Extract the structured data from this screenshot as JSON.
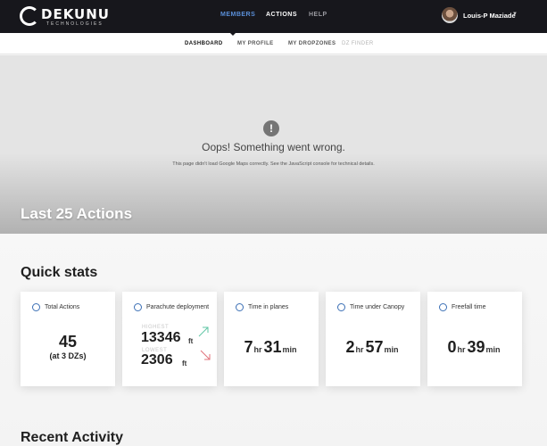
{
  "header": {
    "logo_word": "DEKUNU",
    "logo_tagline": "TECHNOLOGIES",
    "nav": [
      {
        "label": "MEMBERS"
      },
      {
        "label": "ACTIONS"
      },
      {
        "label": "HELP"
      }
    ],
    "user_name": "Louis-P Maziade",
    "colors": {
      "bar": "#17171c",
      "active_link": "#5a8fd8"
    }
  },
  "subnav": {
    "items": [
      {
        "label": "DASHBOARD"
      },
      {
        "label": "MY PROFILE"
      },
      {
        "label": "MY DROPZONES"
      },
      {
        "label": "DZ FINDER"
      }
    ]
  },
  "map": {
    "error_title": "Oops! Something went wrong.",
    "error_detail": "This page didn't load Google Maps correctly. See the JavaScript console for technical details.",
    "overlay_title": "Last 25 Actions"
  },
  "quick_stats": {
    "title": "Quick stats",
    "cards": [
      {
        "label": "Total Actions",
        "icon": "stopwatch-icon",
        "value": "45",
        "sub": "(at 3 DZs)"
      },
      {
        "label": "Parachute deployment",
        "icon": "parachute-icon",
        "ghost_top": "HIGHEST",
        "value_top": "13346",
        "unit_top": "ft",
        "ghost_bottom": "LOWEST",
        "value_bottom": "2306",
        "unit_bottom": "ft"
      },
      {
        "label": "Time in planes",
        "icon": "plane-icon",
        "hours": "7",
        "hr_unit": "hr",
        "minutes": "31",
        "min_unit": "min"
      },
      {
        "label": "Time under Canopy",
        "icon": "canopy-icon",
        "hours": "2",
        "hr_unit": "hr",
        "minutes": "57",
        "min_unit": "min"
      },
      {
        "label": "Freefall time",
        "icon": "freefall-icon",
        "hours": "0",
        "hr_unit": "hr",
        "minutes": "39",
        "min_unit": "min"
      }
    ]
  },
  "recent_activity": {
    "title": "Recent Activity"
  }
}
